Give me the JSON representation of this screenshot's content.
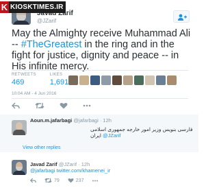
{
  "watermark": {
    "letter": "K",
    "text": "KIOSKTIMES.IR"
  },
  "tweet": {
    "author_name": "Javad Zarif",
    "author_handle": "@JZarif",
    "text_before": "May the Almighty receive Muhammad Ali -- ",
    "hashtag": "#TheGreatest",
    "text_after": " in the ring and in the fight for justice, dignity and peace -- in His infinite mercy.",
    "retweets_label": "RETWEETS",
    "retweets_count": "469",
    "likes_label": "LIKES",
    "likes_count": "1,691",
    "timestamp": "10:04 AM - 4 Jun 2016"
  },
  "colors": {
    "link": "#1b95e0",
    "muted": "#8899a6",
    "like": "#e81c4f",
    "retweet": "#19cf86"
  },
  "replies": [
    {
      "name": "Aoun.m.jafarbagi",
      "handle": "@jafarbagi",
      "time": "· 12h",
      "text": "فارسی بنویس وزیر امور خارجه جمهوری اسلامی ایران",
      "mention": "@JZarif",
      "view_more": "View other replies"
    },
    {
      "name": "Javad Zarif",
      "handle": "@JZarif",
      "time": "· 12h",
      "mention": "@jafarbagi",
      "link": "twitter.com/khamenei_ir",
      "retweets": "79",
      "likes": "237"
    }
  ],
  "icons": {
    "follow": "add-user-icon",
    "reply": "reply-icon",
    "retweet": "retweet-icon",
    "like": "heart-icon",
    "more": "more-icon"
  }
}
